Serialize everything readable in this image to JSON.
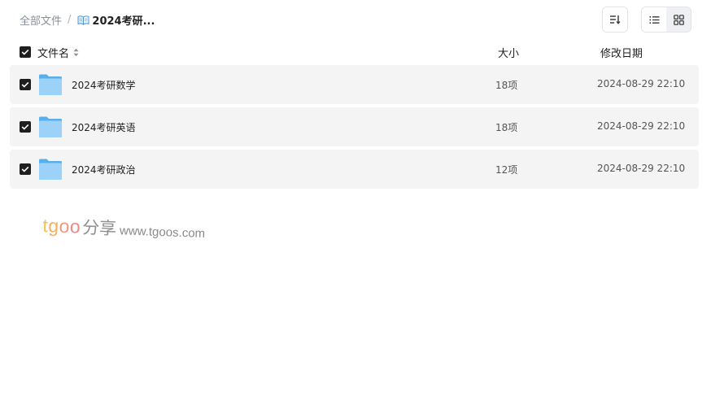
{
  "breadcrumb": {
    "root": "全部文件",
    "separator": "/",
    "current_icon": "open-book-icon",
    "current": "2024考研..."
  },
  "toolbar": {
    "sort_icon": "sort-list-icon",
    "list_view_icon": "list-view-icon",
    "grid_view_icon": "grid-view-icon",
    "active_view": "list"
  },
  "table": {
    "headers": {
      "name": "文件名",
      "size": "大小",
      "modified": "修改日期"
    },
    "rows": [
      {
        "name": "2024考研数学",
        "size": "18项",
        "modified": "2024-08-29 22:10",
        "icon": "folder-icon",
        "checked": true
      },
      {
        "name": "2024考研英语",
        "size": "18项",
        "modified": "2024-08-29 22:10",
        "icon": "folder-icon",
        "checked": true
      },
      {
        "name": "2024考研政治",
        "size": "12项",
        "modified": "2024-08-29 22:10",
        "icon": "folder-icon",
        "checked": true
      }
    ]
  },
  "watermark": {
    "brand_parts": [
      "t",
      "g",
      "o",
      "o"
    ],
    "cn": "分享",
    "url": "www.tgoos.com"
  },
  "colors": {
    "row_background": "#f4f4f5",
    "checkbox": "#1f1f1f",
    "folder": "#8cc8f5",
    "muted_text": "#8a8f99"
  }
}
